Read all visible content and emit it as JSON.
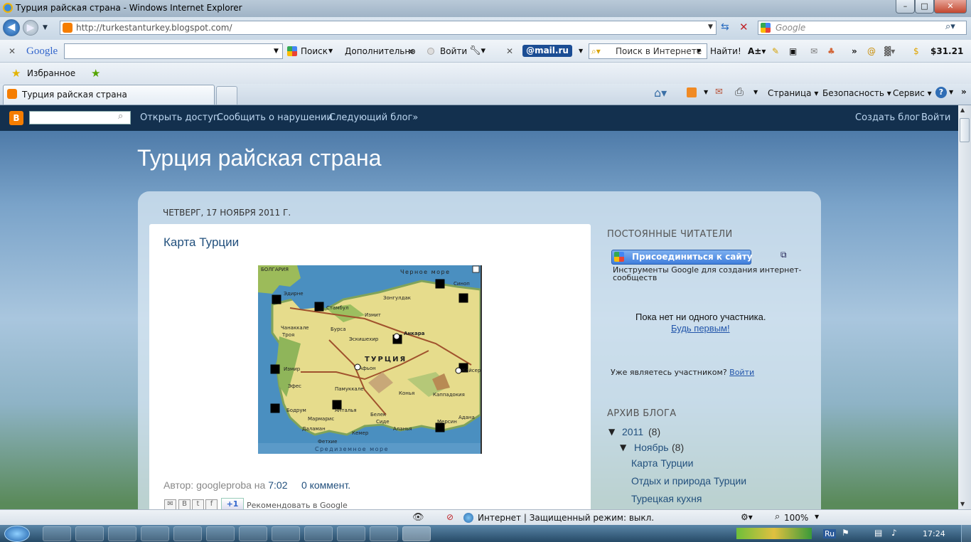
{
  "window": {
    "title": "Турция райская страна - Windows Internet Explorer",
    "minimize": "–",
    "maximize": "□",
    "close": "✕"
  },
  "address": {
    "url": "http://turkestanturkey.blogspot.com/",
    "search_placeholder": "Google"
  },
  "google_toolbar": {
    "logo": "Google",
    "search_label": "Поиск",
    "more_label": "Дополнительно",
    "signin_label": "Войти",
    "mailru_logo": "@mail.ru",
    "internet_search_placeholder": "Поиск в Интернете",
    "find_label": "Найти!",
    "stock_value": "$31.21"
  },
  "favorites": {
    "label": "Избранное"
  },
  "tabs": [
    {
      "label": "Турция райская страна"
    }
  ],
  "command_bar": {
    "page": "Страница",
    "safety": "Безопасность",
    "tools": "Сервис"
  },
  "blogger_nav": {
    "open_access": "Открыть доступ",
    "report_abuse": "Сообщить о нарушении",
    "next_blog": "Следующий блог»",
    "create_blog": "Создать блог",
    "sign_in": "Войти"
  },
  "blog": {
    "title": "Турция райская страна",
    "date_header": "ЧЕТВЕРГ, 17 НОЯБРЯ 2011 Г.",
    "post_title": "Карта Турции",
    "author_prefix": "Автор: googleproba на",
    "time": "7:02",
    "comments": "0 коммент.",
    "share_label": "Рекомендовать в Google",
    "plus_one": "+1"
  },
  "map_labels": {
    "bulgaria": "БОЛГАРИЯ",
    "black_sea": "Черное море",
    "sinop": "Синоп",
    "istanbul": "Стамбул",
    "edirne": "Эдирне",
    "zonguldak": "Зонгулдак",
    "izmit": "Измит",
    "chanakkale": "Чанаккале",
    "bursa": "Бурса",
    "ankara": "Анкара",
    "eskisehir": "Эскишехир",
    "troy": "Троя",
    "turkey": "ТУРЦИЯ",
    "izmir": "Измир",
    "afyon": "Афьон",
    "kayseri": "Кайсери",
    "pamukkale": "Памуккале",
    "efes": "Эфес",
    "kappadokia": "Каппадокия",
    "konya": "Конья",
    "bodrum": "Бодрум",
    "marmaris": "Мармарис",
    "antalya": "Анталья",
    "belek": "Белек",
    "side": "Сиде",
    "dalaman": "Даламан",
    "kemer": "Кемер",
    "alanya": "Аланья",
    "mersin": "Мерсин",
    "adana": "Адана",
    "fethiye": "Фетхие",
    "med_sea": "Средиземное море"
  },
  "sidebar": {
    "followers_header": "ПОСТОЯННЫЕ ЧИТАТЕЛИ",
    "join_button": "Присоединиться к сайту",
    "tools_text_1": "Инструменты Google для создания интернет-",
    "tools_text_2": "сообществ",
    "no_members": "Пока нет ни одного участника.",
    "be_first": "Будь первым!",
    "already_member": "Уже являетесь участником?",
    "login": "Войти",
    "archive_header": "АРХИВ БЛОГА",
    "year": "2011",
    "year_count": "(8)",
    "month": "Ноябрь",
    "month_count": "(8)",
    "posts": [
      "Карта Турции",
      "Отдых и природа Турции",
      "Турецкая кухня"
    ]
  },
  "status": {
    "zone": "Интернет | Защищенный режим: выкл.",
    "zoom": "100%"
  },
  "taskbar": {
    "lang": "Ru",
    "clock": "17:24"
  },
  "colors": {
    "blogger_bar": "#13304e",
    "link": "#22507d",
    "join_button": "#3f7edc"
  }
}
